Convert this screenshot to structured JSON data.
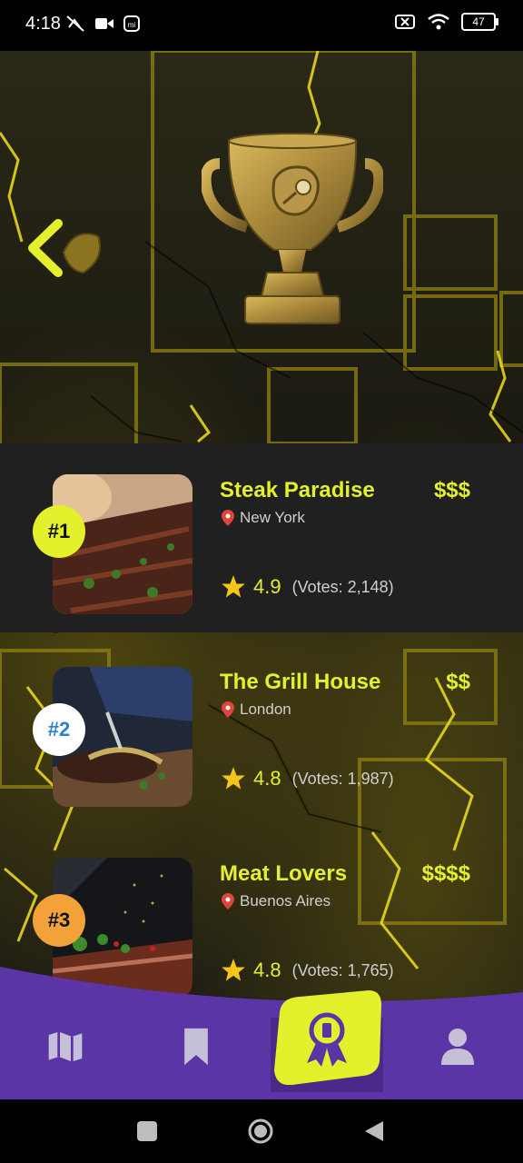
{
  "status": {
    "time": "4:18",
    "battery": "47"
  },
  "colors": {
    "accent": "#e3f02b",
    "nav_purple": "#5b34a5",
    "row_bg": "#202020"
  },
  "icons": {
    "back": "chevron-left-icon",
    "trophy": "trophy-steak-icon",
    "nav": [
      "map-icon",
      "bookmark-icon",
      "award-ribbon-icon",
      "user-icon"
    ]
  },
  "rankings": [
    {
      "rank": "#1",
      "name": "Steak Paradise",
      "price": "$$$",
      "location": "New York",
      "rating": "4.9",
      "votes": "(Votes: 2,148)"
    },
    {
      "rank": "#2",
      "name": "The Grill House",
      "price": "$$",
      "location": "London",
      "rating": "4.8",
      "votes": "(Votes: 1,987)"
    },
    {
      "rank": "#3",
      "name": "Meat Lovers",
      "price": "$$$$",
      "location": "Buenos Aires",
      "rating": "4.8",
      "votes": "(Votes: 1,765)"
    }
  ]
}
